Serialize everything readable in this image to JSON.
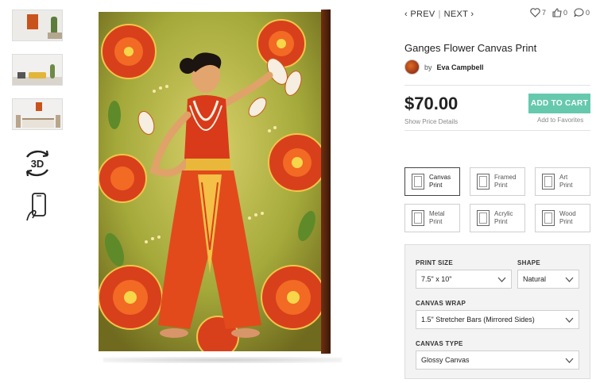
{
  "nav": {
    "prev": "PREV",
    "separator": "|",
    "next": "NEXT"
  },
  "social": {
    "likes": "7",
    "thumbs": "0",
    "comments": "0"
  },
  "product": {
    "title": "Ganges Flower Canvas Print",
    "by": "by",
    "artist": "Eva Campbell",
    "price": "$70.00",
    "price_details": "Show Price Details",
    "add_to_cart": "ADD TO CART",
    "add_to_favorites": "Add to Favorites"
  },
  "product_types": [
    {
      "label": "Canvas\nPrint",
      "selected": true
    },
    {
      "label": "Framed\nPrint",
      "selected": false
    },
    {
      "label": "Art\nPrint",
      "selected": false
    },
    {
      "label": "Metal\nPrint",
      "selected": false
    },
    {
      "label": "Acrylic\nPrint",
      "selected": false
    },
    {
      "label": "Wood\nPrint",
      "selected": false
    }
  ],
  "options": {
    "print_size": {
      "label": "PRINT SIZE",
      "value": "7.5\" x 10\""
    },
    "shape": {
      "label": "SHAPE",
      "value": "Natural"
    },
    "canvas_wrap": {
      "label": "CANVAS WRAP",
      "value": "1.5\" Stretcher Bars (Mirrored Sides)"
    },
    "canvas_type": {
      "label": "CANVAS TYPE",
      "value": "Glossy Canvas"
    }
  },
  "colors": {
    "accent": "#66c9ad",
    "border_selected": "#444444"
  },
  "icons": [
    "3d-view-icon",
    "mobile-ar-icon",
    "heart-icon",
    "thumbs-up-icon",
    "comment-icon",
    "chevron-down-icon"
  ]
}
